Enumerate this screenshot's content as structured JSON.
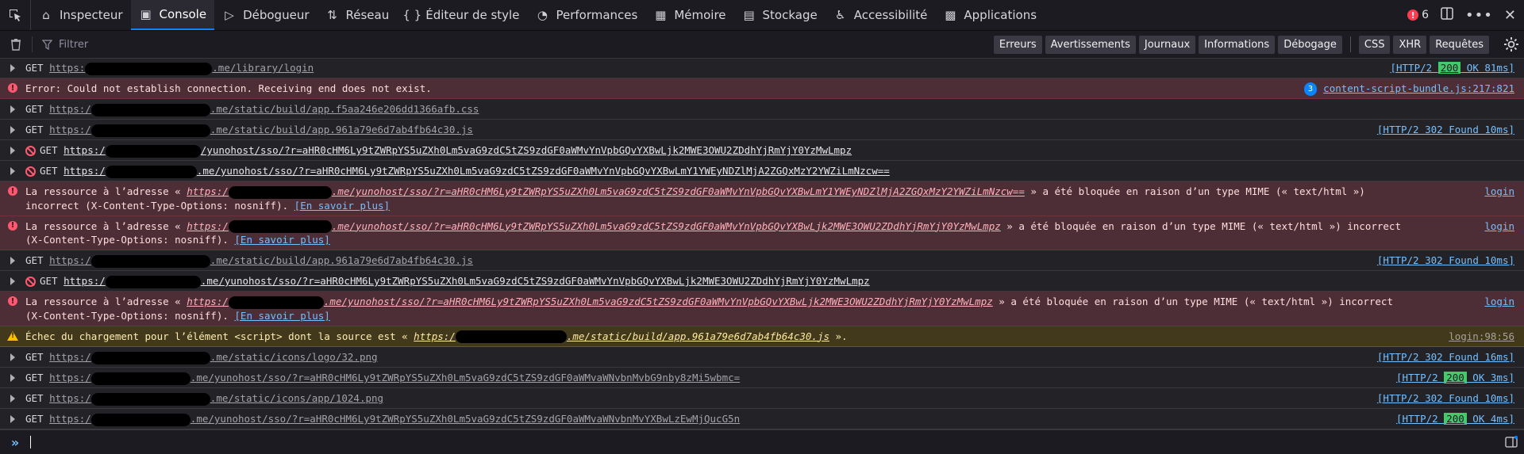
{
  "toolbar": {
    "tabs": [
      {
        "label": "Inspecteur",
        "icon": "inspector-icon"
      },
      {
        "label": "Console",
        "icon": "console-icon",
        "active": true
      },
      {
        "label": "Débogueur",
        "icon": "debugger-icon"
      },
      {
        "label": "Réseau",
        "icon": "network-icon"
      },
      {
        "label": "Éditeur de style",
        "icon": "style-editor-icon"
      },
      {
        "label": "Performances",
        "icon": "performance-icon"
      },
      {
        "label": "Mémoire",
        "icon": "memory-icon"
      },
      {
        "label": "Stockage",
        "icon": "storage-icon"
      },
      {
        "label": "Accessibilité",
        "icon": "accessibility-icon"
      },
      {
        "label": "Applications",
        "icon": "applications-icon"
      }
    ],
    "error_count": "6"
  },
  "filter": {
    "placeholder": "Filtrer",
    "levels": [
      "Erreurs",
      "Avertissements",
      "Journaux",
      "Informations",
      "Débogage"
    ],
    "types": [
      "CSS",
      "XHR",
      "Requêtes"
    ]
  },
  "log": [
    {
      "kind": "net",
      "method": "GET",
      "url_pre": "https:",
      "url_post": ".me/library/login",
      "status": "[HTTP/2 ",
      "code": "200",
      "status_text": " OK 81ms]",
      "ok": true
    },
    {
      "kind": "error",
      "text": "Error: Could not establish connection. Receiving end does not exist.",
      "repeat": "3",
      "source": "content-script-bundle.js:217:821"
    },
    {
      "kind": "net",
      "method": "GET",
      "url_pre": "https:/",
      "url_post": ".me/static/build/app.f5aa246e206dd1366afb.css",
      "status": "",
      "code": "",
      "status_text": "",
      "ok": false
    },
    {
      "kind": "net",
      "method": "GET",
      "url_pre": "https:/",
      "url_post": ".me/static/build/app.961a79e6d7ab4fb64c30.js",
      "status": "[HTTP/2 ",
      "code": "302",
      "status_text": " Found 10ms]",
      "ok": false
    },
    {
      "kind": "blocked",
      "method": "GET",
      "url_pre": "https:/",
      "url_post": "/yunohost/sso/?r=aHR0cHM6Ly9tZWRpYS5uZXh0Lm5vaG9zdC5tZS9zdGF0aWMvYnVpbGQvYXBwLjk2MWE3OWU2ZDdhYjRmYjY0YzMwLmpz"
    },
    {
      "kind": "blocked",
      "method": "GET",
      "url_pre": "https:/",
      "url_post": ".me/yunohost/sso/?r=aHR0cHM6Ly9tZWRpYS5uZXh0Lm5vaG9zdC5tZS9zdGF0aWMvYnVpbGQvYXBwLmY1YWEyNDZlMjA2ZGQxMzY2YWZiLmNzcw=="
    },
    {
      "kind": "mime",
      "pre": "La ressource à l’adresse « ",
      "url_pre": "https:/",
      "url_post": ".me/yunohost/sso/?r=aHR0cHM6Ly9tZWRpYS5uZXh0Lm5vaG9zdC5tZS9zdGF0aWMvYnVpbGQvYXBwLmY1YWEyNDZlMjA2ZGQxMzY2YWZiLmNzcw==",
      "post": " » a été bloquée en raison d’un type MIME (« text/html »)",
      "line2": "incorrect (X-Content-Type-Options: nosniff).",
      "more": "[En savoir plus]",
      "source": "login"
    },
    {
      "kind": "mime",
      "pre": "La ressource à l’adresse « ",
      "url_pre": "https:/",
      "url_post": ".me/yunohost/sso/?r=aHR0cHM6Ly9tZWRpYS5uZXh0Lm5vaG9zdC5tZS9zdGF0aWMvYnVpbGQvYXBwLjk2MWE3OWU2ZDdhYjRmYjY0YzMwLmpz",
      "post": " » a été bloquée en raison d’un type MIME (« text/html ») incorrect",
      "line2": "(X-Content-Type-Options: nosniff).",
      "more": "[En savoir plus]",
      "source": "login"
    },
    {
      "kind": "net",
      "method": "GET",
      "url_pre": "https:/",
      "url_post": ".me/static/build/app.961a79e6d7ab4fb64c30.js",
      "status": "[HTTP/2 ",
      "code": "302",
      "status_text": " Found 10ms]",
      "ok": false
    },
    {
      "kind": "blocked",
      "method": "GET",
      "url_pre": "https:/",
      "url_post": ".me/yunohost/sso/?r=aHR0cHM6Ly9tZWRpYS5uZXh0Lm5vaG9zdC5tZS9zdGF0aWMvYnVpbGQvYXBwLjk2MWE3OWU2ZDdhYjRmYjY0YzMwLmpz"
    },
    {
      "kind": "mime",
      "pre": "La ressource à l’adresse « ",
      "url_pre": "https:/",
      "url_post": ".me/yunohost/sso/?r=aHR0cHM6Ly9tZWRpYS5uZXh0Lm5vaG9zdC5tZS9zdGF0aWMvYnVpbGQvYXBwLjk2MWE3OWU2ZDdhYjRmYjY0YzMwLmpz",
      "post": " » a été bloquée en raison d’un type MIME (« text/html ») incorrect",
      "line2": "(X-Content-Type-Options: nosniff).",
      "more": "[En savoir plus]",
      "source": "login"
    },
    {
      "kind": "warn",
      "pre": "Échec du chargement pour l’élément <script> dont la source est « ",
      "url_pre": "https:/",
      "url_post": ".me/static/build/app.961a79e6d7ab4fb64c30.js",
      "post": " ».",
      "source": "login:98:56"
    },
    {
      "kind": "net",
      "method": "GET",
      "url_pre": "https:/",
      "url_post": ".me/static/icons/logo/32.png",
      "status": "[HTTP/2 ",
      "code": "302",
      "status_text": " Found 16ms]",
      "ok": false
    },
    {
      "kind": "net",
      "method": "GET",
      "url_pre": "https:/",
      "url_post": ".me/yunohost/sso/?r=aHR0cHM6Ly9tZWRpYS5uZXh0Lm5vaG9zdC5tZS9zdGF0aWMvaWNvbnMvbG9nby8zMi5wbmc=",
      "status": "[HTTP/2 ",
      "code": "200",
      "status_text": " OK 3ms]",
      "ok": true
    },
    {
      "kind": "net",
      "method": "GET",
      "url_pre": "https:/",
      "url_post": ".me/static/icons/app/1024.png",
      "status": "[HTTP/2 ",
      "code": "302",
      "status_text": " Found 10ms]",
      "ok": false
    },
    {
      "kind": "net",
      "method": "GET",
      "url_pre": "https:/",
      "url_post": ".me/yunohost/sso/?r=aHR0cHM6Ly9tZWRpYS5uZXh0Lm5vaG9zdC5tZS9zdGF0aWMvaWNvbnMvYXBwLzEwMjQucG5n",
      "status": "[HTTP/2 ",
      "code": "200",
      "status_text": " OK 4ms]",
      "ok": true
    }
  ]
}
